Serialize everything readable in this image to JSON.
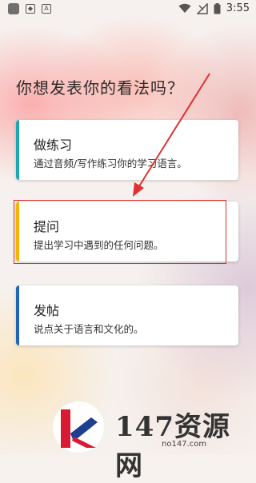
{
  "status_bar": {
    "time": "3:55",
    "icons": [
      "app-square-icon",
      "shield-icon",
      "a-letter-icon",
      "wifi-icon",
      "no-signal-icon",
      "battery-icon"
    ]
  },
  "page": {
    "heading": "你想发表你的看法吗？"
  },
  "options": [
    {
      "title": "做练习",
      "desc": "通过音频/写作练习你的学习语言。",
      "accent": "#1fa7b0"
    },
    {
      "title": "提问",
      "desc": "提出学习中遇到的任何问题。",
      "accent": "#f4b400"
    },
    {
      "title": "发帖",
      "desc": "说点关于语言和文化的。",
      "accent": "#1f66b8"
    }
  ],
  "annotation": {
    "highlight_color": "#e03030"
  },
  "watermark": {
    "text": "147资源网",
    "url": "no147.com"
  }
}
